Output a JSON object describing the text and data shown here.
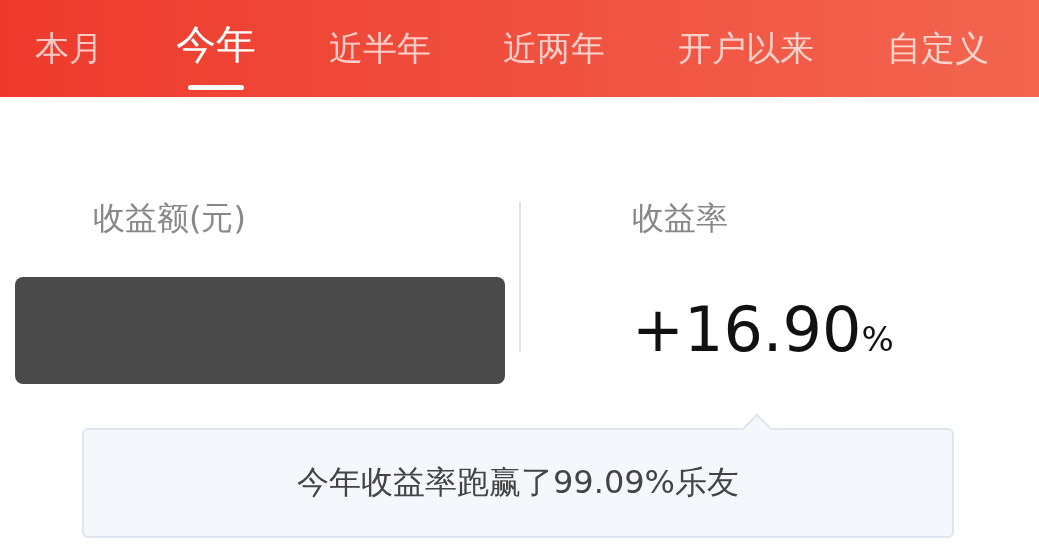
{
  "tabs": [
    {
      "label": "本月",
      "selected": false
    },
    {
      "label": "今年",
      "selected": true
    },
    {
      "label": "近半年",
      "selected": false
    },
    {
      "label": "近两年",
      "selected": false
    },
    {
      "label": "开户以来",
      "selected": false
    },
    {
      "label": "自定义",
      "selected": false
    }
  ],
  "summary": {
    "amount": {
      "label": "收益额(元)",
      "redacted": true
    },
    "rate": {
      "label": "收益率",
      "value": "+16.90",
      "unit": "%"
    }
  },
  "tooltip": {
    "text": "今年收益率跑赢了99.09%乐友"
  }
}
